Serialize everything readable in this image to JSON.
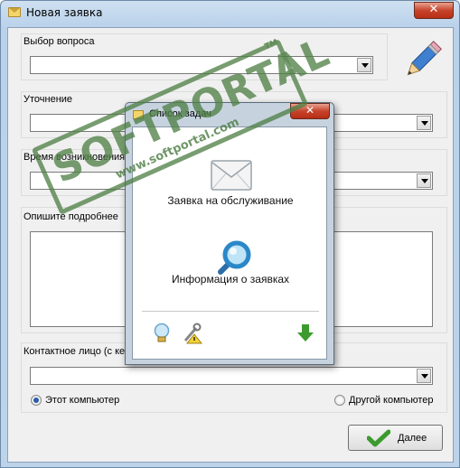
{
  "window": {
    "title": "Новая заявка",
    "close_glyph": "✕"
  },
  "form": {
    "question_label": "Выбор вопроса",
    "question_value": "",
    "clarification_label": "Уточнение",
    "clarification_value": "",
    "time_label": "Время возникновения",
    "time_value": "",
    "details_label": "Опишите подробнее",
    "details_value": "",
    "contact_label": "Контактное лицо (с ке",
    "contact_value": "",
    "radio_this": "Этот компьютер",
    "radio_other": "Другой компьютер",
    "radio_selected": "this",
    "delete_button": "Далее"
  },
  "popup": {
    "title": "Список задач",
    "close_glyph": "✕",
    "item1_label": "Заявка на обслуживание",
    "item2_label": "Информация о заявках",
    "footer_icons": [
      "lightbulb-icon",
      "tools-warning-icon",
      "down-arrow-icon"
    ]
  },
  "watermark": {
    "brand": "SOFTPORTAL",
    "url": "www.softportal.com",
    "tm": "TM"
  },
  "colors": {
    "accent_green": "#3c9a2e",
    "watermark_green": "#4f7f45",
    "close_red": "#c7432b"
  }
}
